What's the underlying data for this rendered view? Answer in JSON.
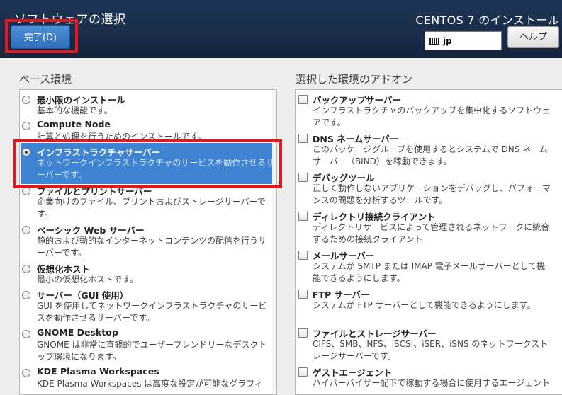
{
  "header": {
    "title": "ソフトウェアの選択",
    "install_title": "CENTOS 7 のインストール",
    "done_label": "完了(D)",
    "keyboard_layout": "jp",
    "help_label": "ヘルプ"
  },
  "base_env": {
    "title": "ベース環境",
    "selected_index": 2,
    "items": [
      {
        "name": "最小限のインストール",
        "desc": "基本的な機能です。"
      },
      {
        "name": "Compute Node",
        "desc": "計算と処理を行うためのインストールです。"
      },
      {
        "name": "インフラストラクチャサーバー",
        "desc": "ネットワークインフラストラクチャのサービスを動作させるサーバーです。"
      },
      {
        "name": "ファイルとプリントサーバー",
        "desc": "企業向けのファイル、プリントおよびストレージサーバーです。"
      },
      {
        "name": "ベーシック Web サーバー",
        "desc": "静的および動的なインターネットコンテンツの配信を行うサーバーです。"
      },
      {
        "name": "仮想化ホスト",
        "desc": "最小の仮想化ホストです。"
      },
      {
        "name": "サーバー（GUI 使用）",
        "desc": "GUI を使用してネットワークインフラストラクチャのサービスを動作させるサーバーです。"
      },
      {
        "name": "GNOME Desktop",
        "desc": "GNOME は非常に直観的でユーザーフレンドリーなデスクトップ環境になります。"
      },
      {
        "name": "KDE Plasma Workspaces",
        "desc": "KDE Plasma Workspaces は高度な設定が可能なグラフィ"
      }
    ]
  },
  "addons": {
    "title": "選択した環境のアドオン",
    "items": [
      {
        "name": "バックアップサーバー",
        "desc": "インフラストラクチャのバックアップを集中化するソフトウェアです。"
      },
      {
        "name": "DNS ネームサーバー",
        "desc": "このパッケージグループを使用するとシステムで DNS ネームサーバー（BIND）を稼動できます。"
      },
      {
        "name": "デバッグツール",
        "desc": "正しく動作しないアプリケーションをデバッグし、パフォーマンスの問題を分析するツールです。"
      },
      {
        "name": "ディレクトリ接続クライアント",
        "desc": "ディレクトリサービスによって管理されるネットワークに統合するための接続クライアント"
      },
      {
        "name": "メールサーバー",
        "desc": "システムが SMTP または IMAP 電子メールサーバーとして機能できるようにします。"
      },
      {
        "name": "FTP サーバー",
        "desc": "システムが FTP サーバーとして機能できるようにします。"
      },
      {
        "name": "ファイルとストレージサーバー",
        "desc": "CIFS、SMB、NFS、iSCSI、iSER、iSNS のネットワークストレージサーバーです。"
      },
      {
        "name": "ゲストエージェント",
        "desc": "ハイパーバイザー配下で稼動する場合に使用するエージェント"
      }
    ]
  }
}
